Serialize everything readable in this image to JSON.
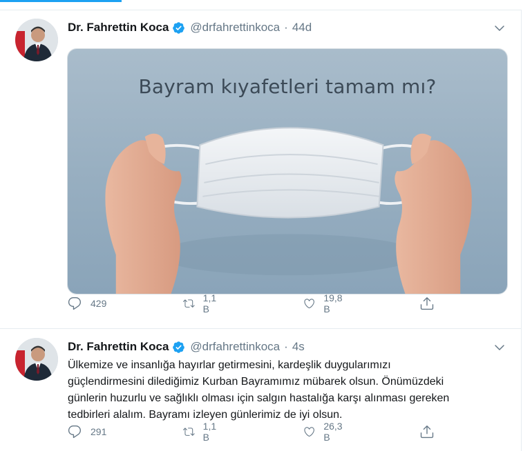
{
  "tweets": [
    {
      "name": "Dr. Fahrettin Koca",
      "handle": "@drfahrettinkoca",
      "separator": "·",
      "time": "44d",
      "image_caption": "Bayram kıyafetleri tamam mı?",
      "replies": "429",
      "retweets": "1,1 B",
      "likes": "19,8 B"
    },
    {
      "name": "Dr. Fahrettin Koca",
      "handle": "@drfahrettinkoca",
      "separator": "·",
      "time": "4s",
      "text_lines": [
        "Ülkemize ve insanlığa hayırlar getirmesini, kardeşlik duygularımızı",
        "güçlendirmesini dilediğimiz Kurban Bayramımız mübarek olsun. Önümüzdeki",
        "günlerin huzurlu ve sağlıklı olması için salgın hastalığa karşı alınması gereken",
        "tedbirleri alalım. Bayramı izleyen günlerimiz de iyi olsun."
      ],
      "replies": "291",
      "retweets": "1,1 B",
      "likes": "26,3 B"
    }
  ],
  "icons": [
    "verified-badge-icon",
    "chevron-down-icon",
    "reply-icon",
    "retweet-icon",
    "like-icon",
    "share-icon"
  ],
  "colors": {
    "accent": "#1da1f2",
    "secondary_text": "#657786",
    "primary_text": "#14171a",
    "border": "#e6ecf0"
  }
}
